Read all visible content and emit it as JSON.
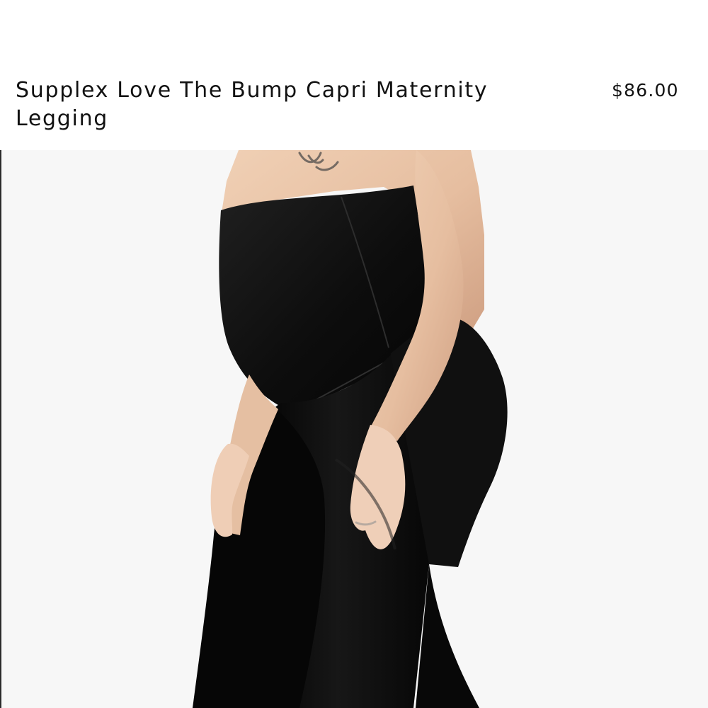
{
  "product": {
    "title": "Supplex Love The Bump Capri Maternity Legging",
    "price": "$86.00"
  },
  "image": {
    "subject": "maternity-legging-product-photo",
    "background_color": "#f7f7f7",
    "skin_color": "#e8c4a6",
    "garment_color": "#111111"
  }
}
